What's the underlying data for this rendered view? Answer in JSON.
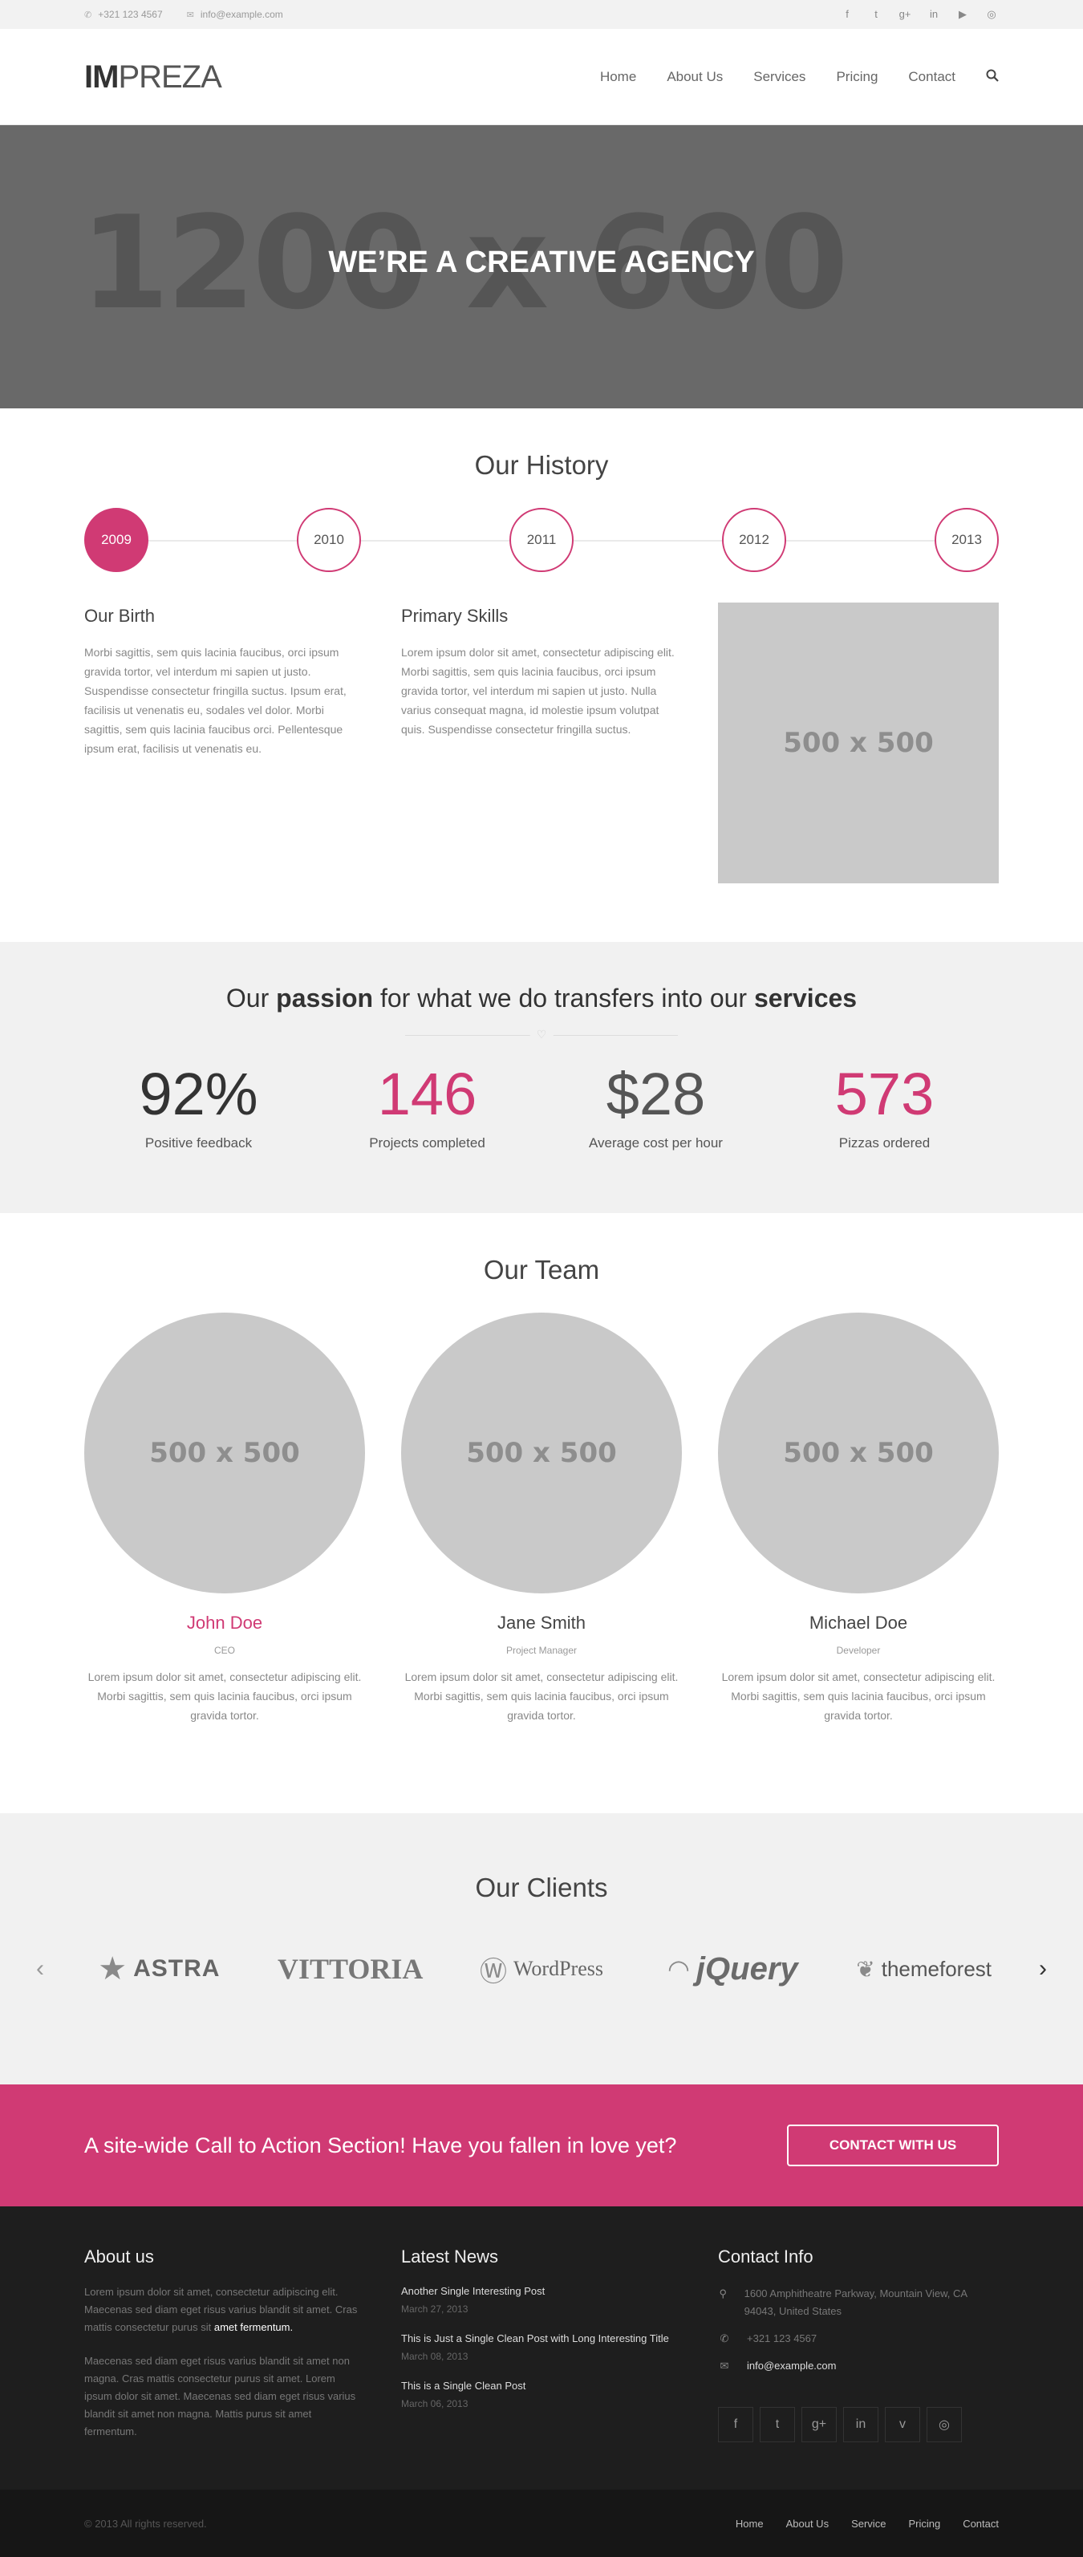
{
  "topbar": {
    "phone": "+321 123 4567",
    "email": "info@example.com",
    "social_icons": [
      "facebook-icon",
      "twitter-icon",
      "google-plus-icon",
      "linkedin-icon",
      "youtube-icon",
      "dribbble-icon"
    ]
  },
  "header": {
    "logo_bold": "IM",
    "logo_rest": "PREZA",
    "nav": [
      "Home",
      "About Us",
      "Services",
      "Pricing",
      "Contact"
    ]
  },
  "hero": {
    "placeholder": "1200 x 600",
    "title": "WE’RE A CREATIVE AGENCY"
  },
  "history": {
    "title": "Our History",
    "years": [
      "2009",
      "2010",
      "2011",
      "2012",
      "2013"
    ],
    "active_year": "2009",
    "col1_title": "Our Birth",
    "col1_text": "Morbi sagittis, sem quis lacinia faucibus, orci ipsum gravida tortor, vel interdum mi sapien ut justo. Suspendisse consectetur fringilla suctus. Ipsum erat, facilisis ut venenatis eu, sodales vel dolor. Morbi sagittis, sem quis lacinia faucibus orci. Pellentesque ipsum erat, facilisis ut venenatis eu.",
    "col2_title": "Primary Skills",
    "col2_text": "Lorem ipsum dolor sit amet, consectetur adipiscing elit. Morbi sagittis, sem quis lacinia faucibus, orci ipsum gravida tortor, vel interdum mi sapien ut justo. Nulla varius consequat magna, id molestie ipsum volutpat quis. Suspendisse consectetur fringilla suctus.",
    "image_placeholder": "500 x 500"
  },
  "stats": {
    "heading_pre": "Our ",
    "heading_b1": "passion",
    "heading_mid": " for what we do transfers into our ",
    "heading_b2": "services",
    "divider_icon": "♡",
    "items": [
      {
        "value": "92%",
        "label": "Positive feedback"
      },
      {
        "value": "146",
        "label": "Projects completed"
      },
      {
        "value": "$28",
        "label": "Average cost per hour"
      },
      {
        "value": "573",
        "label": "Pizzas ordered"
      }
    ]
  },
  "team": {
    "title": "Our Team",
    "members": [
      {
        "photo": "500 x 500",
        "name": "John Doe",
        "role": "CEO",
        "bio": "Lorem ipsum dolor sit amet, consectetur adipiscing elit. Morbi sagittis, sem quis lacinia faucibus, orci ipsum gravida tortor."
      },
      {
        "photo": "500 x 500",
        "name": "Jane Smith",
        "role": "Project Manager",
        "bio": "Lorem ipsum dolor sit amet, consectetur adipiscing elit. Morbi sagittis, sem quis lacinia faucibus, orci ipsum gravida tortor."
      },
      {
        "photo": "500 x 500",
        "name": "Michael Doe",
        "role": "Developer",
        "bio": "Lorem ipsum dolor sit amet, consectetur adipiscing elit. Morbi sagittis, sem quis lacinia faucibus, orci ipsum gravida tortor."
      }
    ]
  },
  "clients": {
    "title": "Our Clients",
    "logos": [
      "ASTRA",
      "VITTORIA",
      "WordPress",
      "jQuery",
      "themeforest"
    ]
  },
  "cta": {
    "text": "A site-wide Call to Action Section! Have you fallen in love yet?",
    "button": "CONTACT WITH US"
  },
  "footer": {
    "about_title": "About us",
    "about_p1": "Lorem ipsum dolor sit amet, consectetur adipiscing elit. Maecenas sed diam eget risus varius blandit sit amet. Cras mattis consectetur purus sit ",
    "about_p1_highlight": "amet fermentum.",
    "about_p2": "Maecenas sed diam eget risus varius blandit sit amet non magna. Cras mattis consectetur purus sit amet. Lorem ipsum dolor sit amet. Maecenas sed diam eget risus varius blandit sit amet non magna. Mattis purus sit amet fermentum.",
    "news_title": "Latest News",
    "news": [
      {
        "title": "Another Single Interesting Post",
        "date": "March 27, 2013"
      },
      {
        "title": "This is Just a Single Clean Post with Long Interesting Title",
        "date": "March 08, 2013"
      },
      {
        "title": "This is a Single Clean Post",
        "date": "March 06, 2013"
      }
    ],
    "contact_title": "Contact Info",
    "address": "1600 Amphitheatre Parkway, Mountain View, CA 94043, United States",
    "phone": "+321 123 4567",
    "email": "info@example.com",
    "social_icons": [
      "facebook-icon",
      "twitter-icon",
      "google-plus-icon",
      "linkedin-icon",
      "vimeo-icon",
      "dribbble-icon"
    ]
  },
  "bottom": {
    "copyright": "© 2013 All rights reserved.",
    "nav": [
      "Home",
      "About Us",
      "Service",
      "Pricing",
      "Contact"
    ]
  },
  "colors": {
    "accent": "#d03a74",
    "hero_bg": "#696969",
    "footer_bg": "#1e1e1e"
  }
}
